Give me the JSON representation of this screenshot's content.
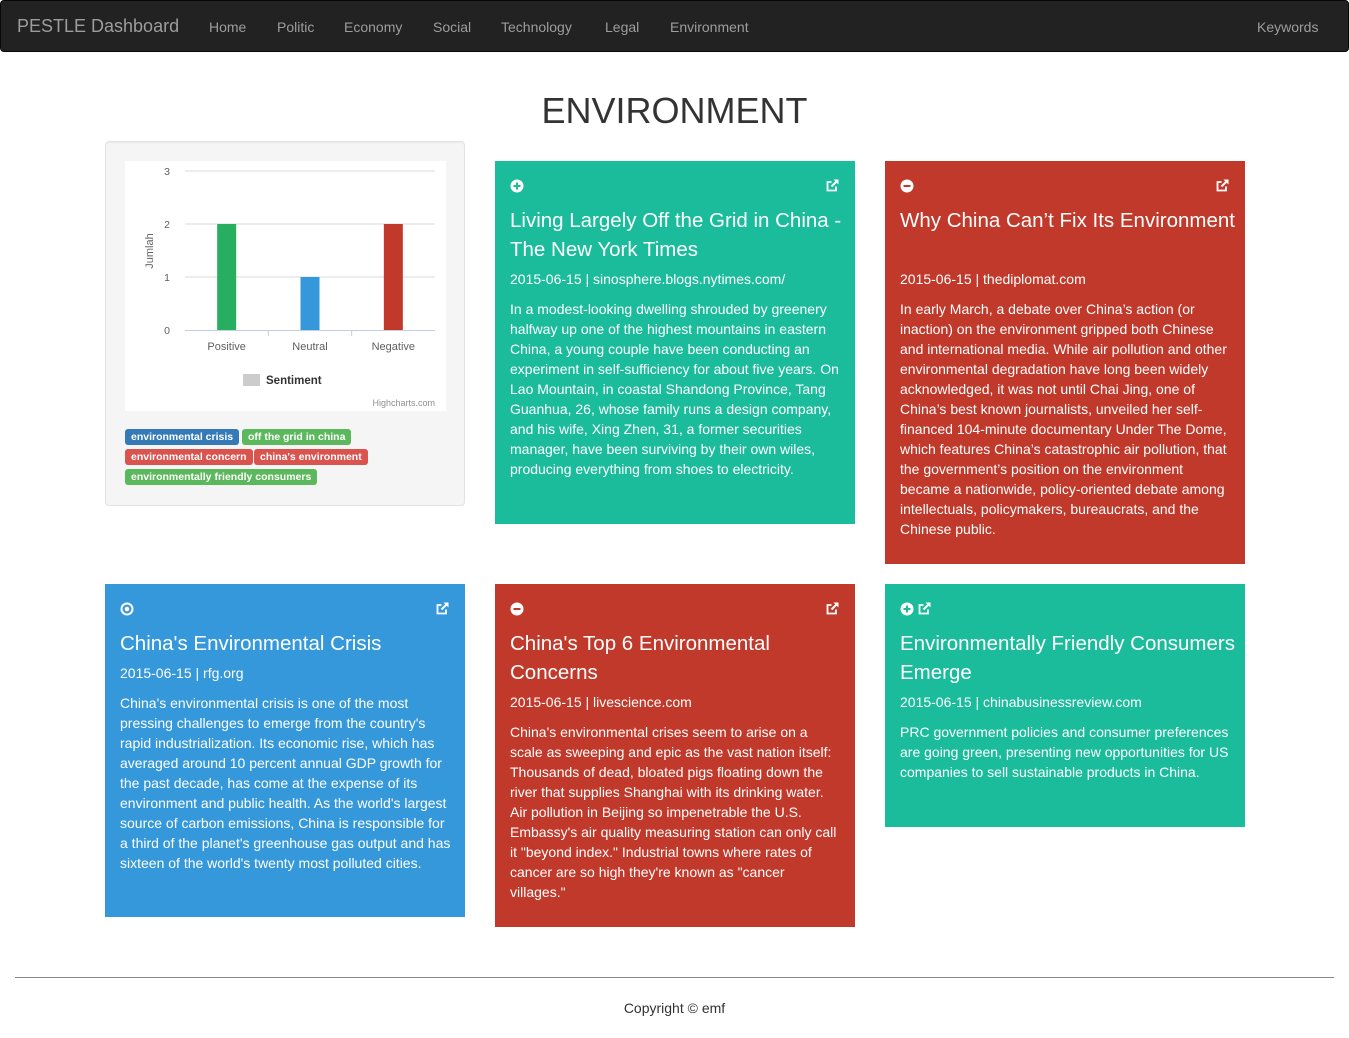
{
  "navbar": {
    "brand": "PESTLE Dashboard",
    "items": [
      "Home",
      "Politic",
      "Economy",
      "Social",
      "Technology",
      "Legal",
      "Environment"
    ],
    "right_item": "Keywords"
  },
  "page": {
    "title": "ENVIRONMENT"
  },
  "chart_data": {
    "type": "bar",
    "categories": [
      "Positive",
      "Neutral",
      "Negative"
    ],
    "values": [
      2,
      1,
      2
    ],
    "colors": [
      "#27ae60",
      "#3498db",
      "#c0392b"
    ],
    "ylabel": "Jumlah",
    "yticks": [
      "0",
      "1",
      "2",
      "3"
    ],
    "ylim": [
      0,
      3
    ],
    "legend": "Sentiment",
    "legend_placement": "bottom",
    "credits": "Highcharts.com",
    "grid": true
  },
  "keywords": [
    {
      "label": "environmental crisis",
      "color": "#337ab7"
    },
    {
      "label": "off the grid in china",
      "color": "#5cb85c"
    },
    {
      "label": "environmental concern",
      "color": "#d9534f"
    },
    {
      "label": "china's environment",
      "color": "#d9534f"
    },
    {
      "label": "environmentally friendly consumers",
      "color": "#5cb85c"
    }
  ],
  "articles": [
    {
      "sentiment_icon": "plus-circle-icon",
      "title": "Living Largely Off the Grid in China - The New York Times",
      "meta": "2015-06-15 | sinosphere.blogs.nytimes.com/",
      "body": "In a modest-looking dwelling shrouded by greenery halfway up one of the highest mountains in eastern China, a young couple have been conducting an experiment in self-sufficiency for about five years. On Lao Mountain, in coastal Shandong Province, Tang Guanhua, 26, whose family runs a design company, and his wife, Xing Zhen, 31, a former securities manager, have been surviving by their own wiles, producing everything from shoes to electricity."
    },
    {
      "sentiment_icon": "minus-circle-icon",
      "title": "Why China Can’t Fix Its Environment",
      "meta": "2015-06-15 | thediplomat.com",
      "body": "In early March, a debate over China’s action (or inaction) on the environment gripped both Chinese and international media. While air pollution and other environmental degradation have long been widely acknowledged, it was not until Chai Jing, one of China’s best known journalists, unveiled her self-financed 104-minute documentary Under The Dome, which features China’s catastrophic air pollution, that the government’s position on the environment became a nationwide, policy-oriented debate among intellectuals, policymakers, bureaucrats, and the Chinese public."
    },
    {
      "sentiment_icon": "dot-circle-icon",
      "title": "China's Environmental Crisis",
      "meta": "2015-06-15 | rfg.org",
      "body": "China's environmental crisis is one of the most pressing challenges to emerge from the country's rapid industrialization. Its economic rise, which has averaged around 10 percent annual GDP growth for the past decade, has come at the expense of its environment and public health. As the world's largest source of carbon emissions, China is responsible for a third of the planet's greenhouse gas output and has sixteen of the world's twenty most polluted cities."
    },
    {
      "sentiment_icon": "minus-circle-icon",
      "title": "China's Top 6 Environmental Concerns",
      "meta": "2015-06-15 | livescience.com",
      "body": "China's environmental crises seem to arise on a scale as sweeping and epic as the vast nation itself: Thousands of dead, bloated pigs floating down the river that supplies Shanghai with its drinking water. Air pollution in Beijing so impenetrable the U.S. Embassy's air quality measuring station can only call it \"beyond index.\" Industrial towns where rates of cancer are so high they're known as \"cancer villages.\""
    },
    {
      "sentiment_icon": "plus-circle-icon",
      "title": "Environmentally Friendly Consumers Emerge",
      "meta": "2015-06-15 | chinabusinessreview.com",
      "body": "PRC government policies and consumer preferences are going green, presenting new opportunities for US companies to sell sustainable products in China."
    }
  ],
  "footer": {
    "copyright": "Copyright © emf"
  }
}
